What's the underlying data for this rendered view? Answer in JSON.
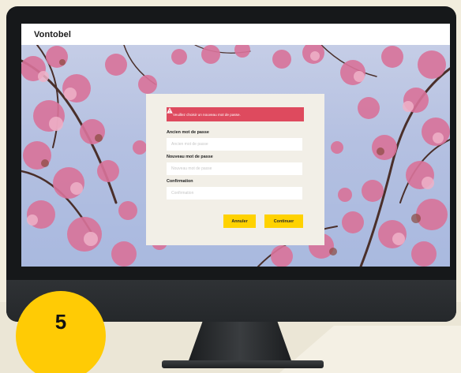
{
  "app": {
    "brand": "Vontobel"
  },
  "dialog": {
    "alert_text": "Veuillez choisir un nouveau mot de passe.",
    "fields": [
      {
        "label": "Ancien mot de passe",
        "placeholder": "Ancien mot de passe",
        "value": ""
      },
      {
        "label": "Nouveau mot de passe",
        "placeholder": "Nouveau mot de passe",
        "value": ""
      },
      {
        "label": "Confirmation",
        "placeholder": "Confirmation",
        "value": ""
      }
    ],
    "buttons": {
      "cancel": "Annuler",
      "continue": "Continuer"
    }
  },
  "step": {
    "number": "5"
  },
  "colors": {
    "accent_yellow": "#ffd200",
    "alert_red": "#de4a5e",
    "dialog_bg": "#f2efe7",
    "sky": "#b4c0e1",
    "blossom": "#d9739a",
    "branch": "#4a2f2a"
  },
  "icons": {
    "alert": "warning-triangle-icon"
  }
}
